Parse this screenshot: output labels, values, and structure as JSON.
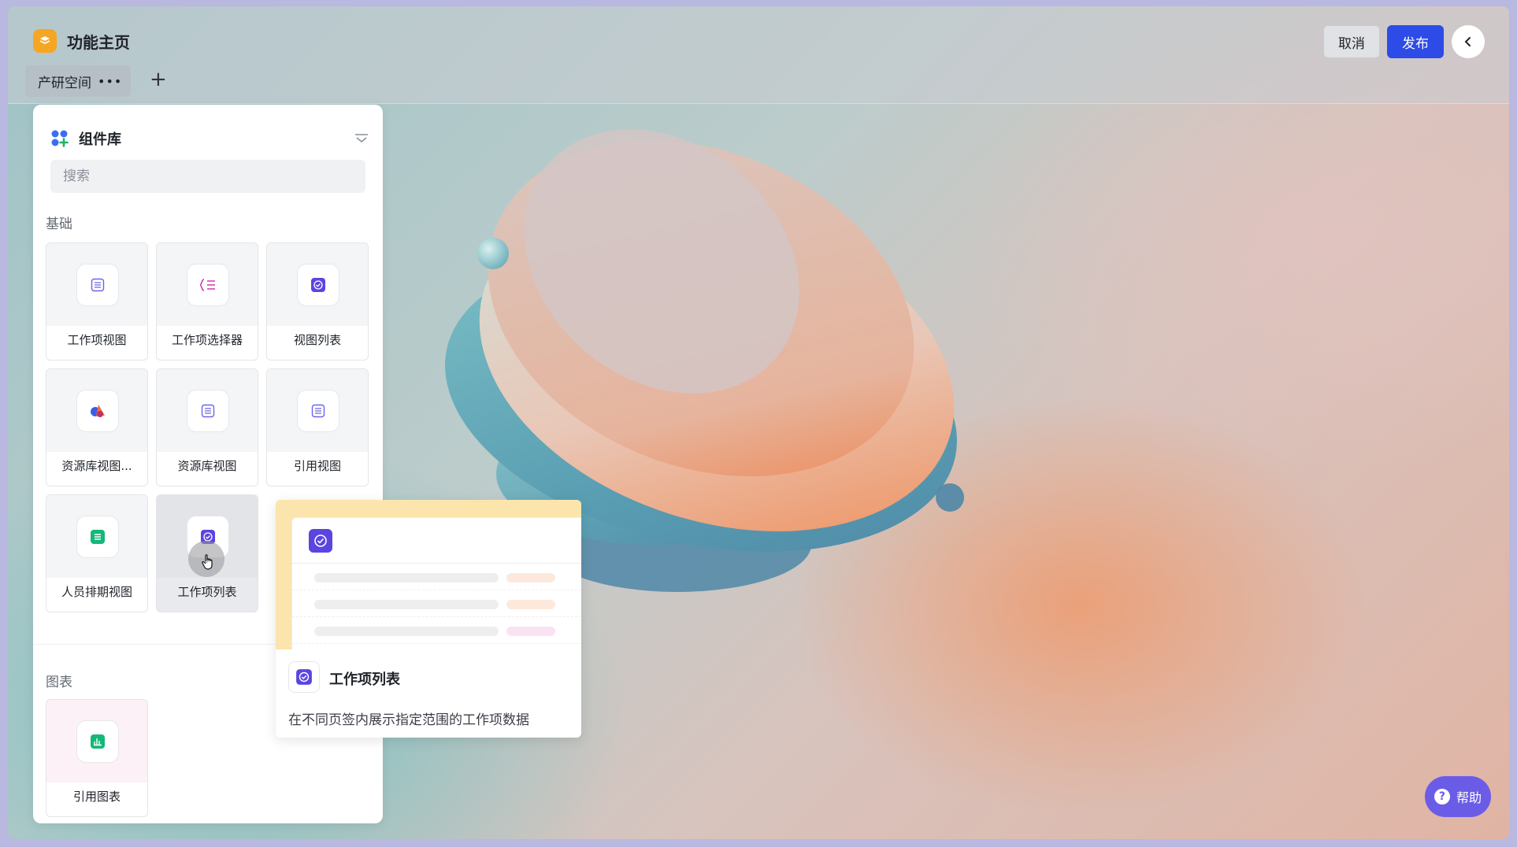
{
  "app": {
    "title": "功能主页"
  },
  "tabs": {
    "active": "产研空间",
    "more_icon": "more-dots-icon",
    "add_icon": "plus-icon"
  },
  "toolbar": {
    "cancel_label": "取消",
    "publish_label": "发布",
    "collapse_icon": "chevron-left-icon"
  },
  "library": {
    "title": "组件库",
    "search_placeholder": "搜索",
    "sections": [
      {
        "label": "基础",
        "items": [
          {
            "label": "工作项视图",
            "icon": "list-doc-icon"
          },
          {
            "label": "工作项选择器",
            "icon": "list-select-icon"
          },
          {
            "label": "视图列表",
            "icon": "check-badge-icon"
          },
          {
            "label": "资源库视图...",
            "icon": "shapes-icon"
          },
          {
            "label": "资源库视图",
            "icon": "list-doc-icon"
          },
          {
            "label": "引用视图",
            "icon": "list-doc-icon"
          },
          {
            "label": "人员排期视图",
            "icon": "table-green-icon"
          },
          {
            "label": "工作项列表",
            "icon": "check-badge-icon"
          }
        ]
      },
      {
        "label": "图表",
        "items": [
          {
            "label": "引用图表",
            "icon": "chart-green-icon"
          }
        ]
      }
    ]
  },
  "popover": {
    "title": "工作项列表",
    "description": "在不同页签内展示指定范围的工作项数据"
  },
  "help": {
    "label": "帮助"
  },
  "colors": {
    "accent": "#2d4be6",
    "logo": "#f5a623",
    "help": "#6b5ce7",
    "component_purple": "#5b45e0",
    "component_green": "#14b879"
  }
}
